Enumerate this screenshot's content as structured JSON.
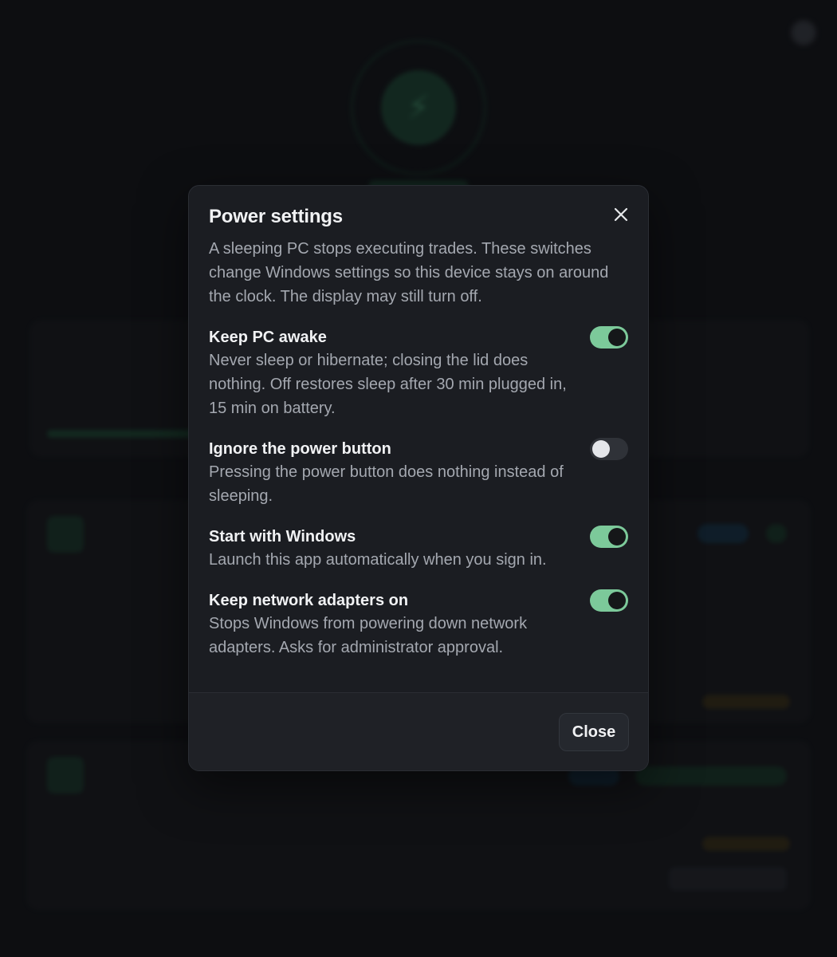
{
  "dialog": {
    "title": "Power settings",
    "description": "A sleeping PC stops executing trades. These switches change Windows settings so this device stays on around the clock. The display may still turn off.",
    "close_icon": "close-icon",
    "settings": [
      {
        "title": "Keep PC awake",
        "description": "Never sleep or hibernate; closing the lid does nothing. Off restores sleep after 30 min plugged in, 15 min on battery.",
        "enabled": true
      },
      {
        "title": "Ignore the power button",
        "description": "Pressing the power button does nothing instead of sleeping.",
        "enabled": false
      },
      {
        "title": "Start with Windows",
        "description": "Launch this app automatically when you sign in.",
        "enabled": true
      },
      {
        "title": "Keep network adapters on",
        "description": "Stops Windows from powering down network adapters. Asks for administrator approval.",
        "enabled": true
      }
    ],
    "footer": {
      "close_label": "Close"
    }
  },
  "colors": {
    "toggle_on": "#7cc99a",
    "toggle_off": "#2f3238",
    "dialog_bg": "#1b1d22",
    "page_bg": "#111317"
  }
}
